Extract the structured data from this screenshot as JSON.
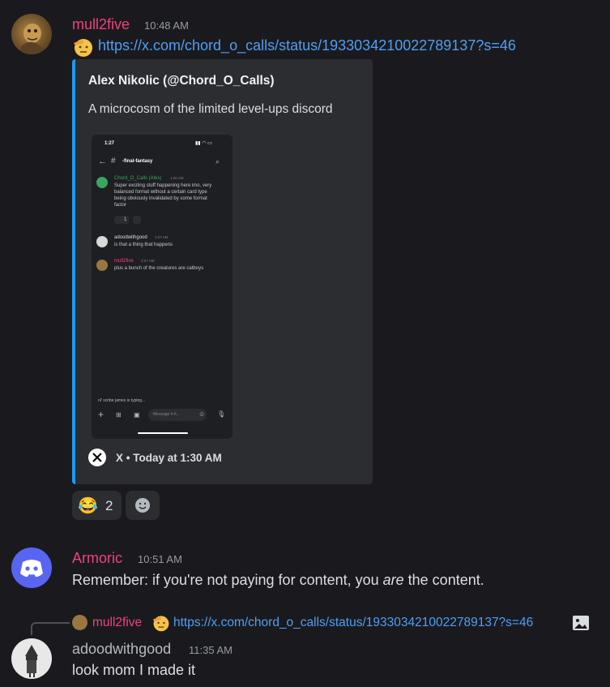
{
  "messages": [
    {
      "author": "mull2five",
      "author_color": "#f0427e",
      "timestamp": "10:48 AM",
      "link": "https://x.com/chord_o_calls/status/1933034210022789137?s=46",
      "embed": {
        "author": "Alex Nikolic (@Chord_O_Calls)",
        "description": "A microcosm of the limited level-ups discord",
        "footer": "X • Today at 1:30 AM",
        "accent": "#1d9bf0",
        "screenshot": {
          "time": "1:27",
          "channel": "-final-fantasy",
          "msgs": [
            {
              "name": "Chord_O_Calls (Alex)",
              "time": "1:26 AM",
              "lines": [
                "Super exciting stuff happening here imo, very",
                "balanced format without a certain card type",
                "being obviously invalidated by some format",
                "factor"
              ]
            },
            {
              "name": "adoodwithgood",
              "time": "1:27 AM",
              "lines": [
                "is that a thing that happens"
              ]
            },
            {
              "name": "mull2five",
              "time": "1:27 AM",
              "lines": [
                "plus a bunch of the creatures are catboys"
              ]
            }
          ],
          "reaction_count": "1",
          "typing": "ol' scribe james is typing...",
          "message_placeholder": "Message #-fi..."
        }
      },
      "reactions": [
        {
          "emoji": "😂",
          "count": "2"
        },
        {
          "emoji": "add-reaction-icon",
          "count": ""
        }
      ]
    },
    {
      "author": "Armoric",
      "author_color": "#f0427e",
      "timestamp": "10:51 AM",
      "text_before": "Remember: if you're not paying for content, you ",
      "text_em": "are",
      "text_after": " the content."
    },
    {
      "reply": {
        "author": "mull2five",
        "link": "https://x.com/chord_o_calls/status/1933034210022789137?s=46"
      },
      "author": "adoodwithgood",
      "author_color": "#b5bac1",
      "timestamp": "11:35 AM",
      "text": "look mom I made it"
    }
  ]
}
